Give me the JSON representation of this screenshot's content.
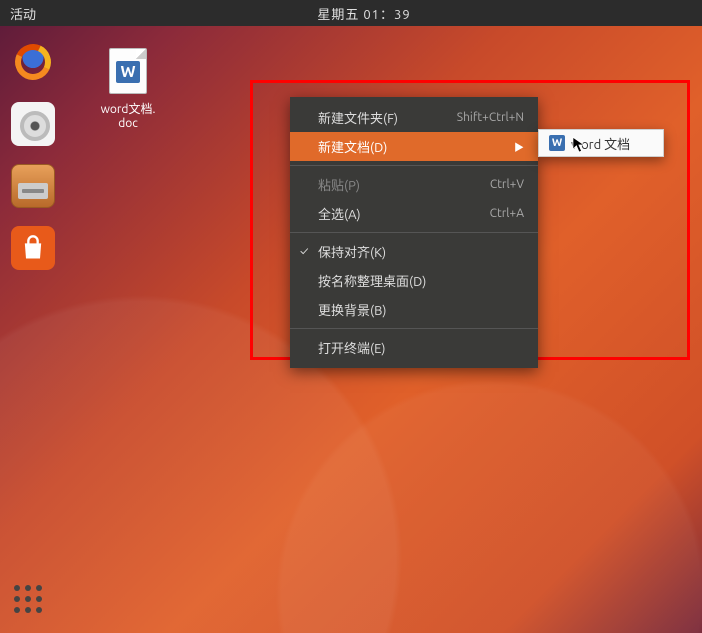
{
  "topbar": {
    "activities": "活动",
    "clock": "星期五 01：39"
  },
  "dock": {
    "items": [
      {
        "name": "firefox"
      },
      {
        "name": "rhythmbox"
      },
      {
        "name": "files"
      },
      {
        "name": "software"
      }
    ]
  },
  "desktop": {
    "icon_letter": "W",
    "icon_label_line1": "word文档.",
    "icon_label_line2": "doc"
  },
  "context_menu": {
    "items": [
      {
        "label": "新建文件夹(F)",
        "accel": "Shift+Ctrl+N",
        "state": "normal"
      },
      {
        "label": "新建文档(D)",
        "accel": "",
        "state": "active",
        "submenu": true
      },
      {
        "sep": true
      },
      {
        "label": "粘贴(P)",
        "accel": "Ctrl+V",
        "state": "disabled"
      },
      {
        "label": "全选(A)",
        "accel": "Ctrl+A",
        "state": "normal"
      },
      {
        "sep": true
      },
      {
        "label": "保持对齐(K)",
        "accel": "",
        "state": "normal",
        "checked": true
      },
      {
        "label": "按名称整理桌面(D)",
        "accel": "",
        "state": "normal"
      },
      {
        "label": "更换背景(B)",
        "accel": "",
        "state": "normal"
      },
      {
        "sep": true
      },
      {
        "label": "打开终端(E)",
        "accel": "",
        "state": "normal"
      }
    ]
  },
  "submenu": {
    "icon_letter": "W",
    "label": "word 文档"
  }
}
